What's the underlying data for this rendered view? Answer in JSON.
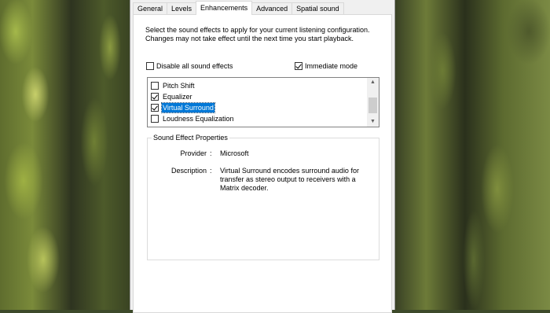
{
  "tabs": [
    {
      "label": "General"
    },
    {
      "label": "Levels"
    },
    {
      "label": "Enhancements"
    },
    {
      "label": "Advanced"
    },
    {
      "label": "Spatial sound"
    }
  ],
  "active_tab": "Enhancements",
  "intro_text": "Select the sound effects to apply for your current listening configuration. Changes may not take effect until the next time you start playback.",
  "options": {
    "disable_all": {
      "label": "Disable all sound effects",
      "checked": false
    },
    "immediate_mode": {
      "label": "Immediate mode",
      "checked": true
    }
  },
  "effects": [
    {
      "label": "Pitch Shift",
      "checked": false,
      "selected": false
    },
    {
      "label": "Equalizer",
      "checked": true,
      "selected": false
    },
    {
      "label": "Virtual Surround",
      "checked": true,
      "selected": true
    },
    {
      "label": "Loudness Equalization",
      "checked": false,
      "selected": false
    }
  ],
  "properties": {
    "group_title": "Sound Effect Properties",
    "provider_label": "Provider",
    "provider_value": "Microsoft",
    "description_label": "Description",
    "description_value": "Virtual Surround encodes surround audio for transfer as stereo output to receivers with a Matrix decoder.",
    "separator": ":"
  },
  "scrollbar": {
    "up_icon": "▲",
    "down_icon": "▼"
  }
}
